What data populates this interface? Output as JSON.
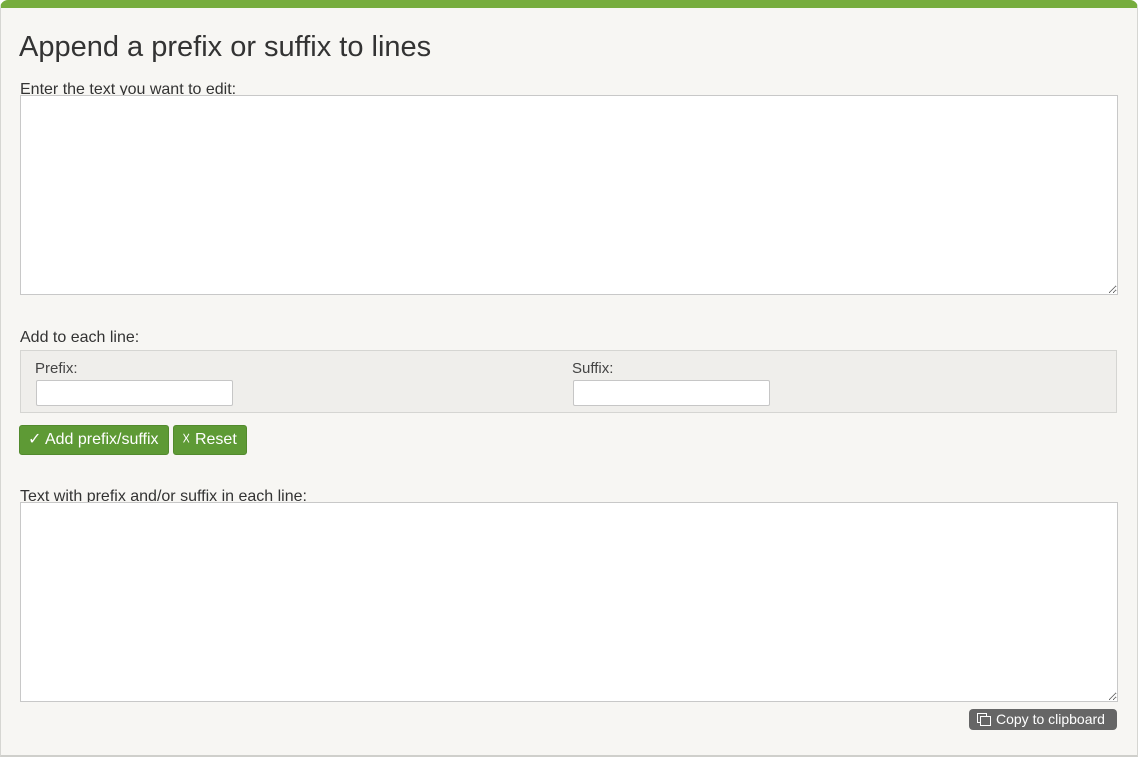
{
  "page": {
    "title": "Append a prefix or suffix to lines",
    "accent_color": "#77ad3e"
  },
  "input_section": {
    "label": "Enter the text you want to edit:",
    "value": ""
  },
  "add_section": {
    "label": "Add to each line:",
    "prefix_label": "Prefix:",
    "prefix_value": "",
    "suffix_label": "Suffix:",
    "suffix_value": ""
  },
  "actions": {
    "add_button": "✓ Add prefix/suffix",
    "reset_button": "☓ Reset",
    "button_color": "#5e9a35"
  },
  "output_section": {
    "label": "Text with prefix and/or suffix in each line:",
    "value": ""
  },
  "copy": {
    "icon": "copy-icon",
    "label": "Copy to clipboard"
  }
}
